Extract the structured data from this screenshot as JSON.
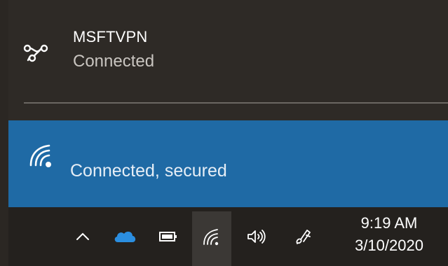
{
  "vpn": {
    "name": "MSFTVPN",
    "status": "Connected",
    "icon": "vpn-link-icon"
  },
  "wifi": {
    "status": "Connected, secured",
    "icon": "wifi-icon"
  },
  "taskbar": {
    "icons": [
      "chevron-up-icon",
      "onedrive-cloud-icon",
      "battery-icon",
      "wifi-network-icon",
      "volume-icon",
      "pen-icon"
    ],
    "time": "9:19 AM",
    "date": "3/10/2020"
  },
  "colors": {
    "flyout_bg": "#2e2a26",
    "selected_bg": "#1f6aa5",
    "taskbar_bg": "#24211e",
    "onedrive_blue": "#2b8ee0"
  }
}
